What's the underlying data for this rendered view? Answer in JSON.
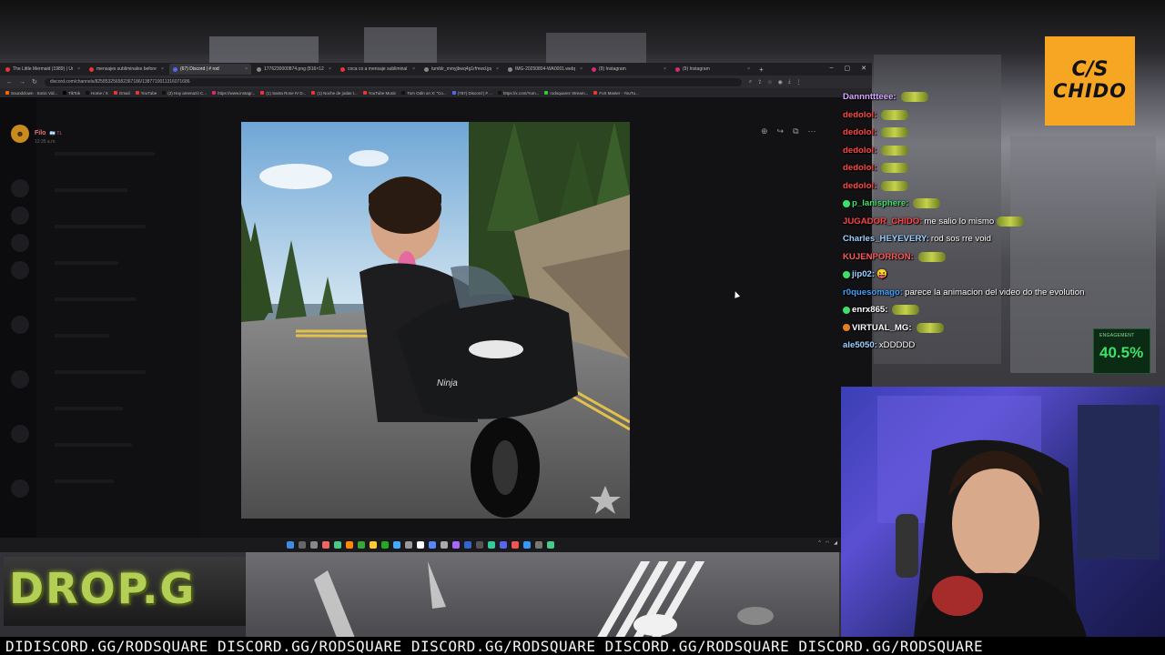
{
  "browser": {
    "tabs": [
      {
        "label": "The Little Mermaid (1989) | Un",
        "color": "#e33"
      },
      {
        "label": "mensajes subliminales before",
        "color": "#e33"
      },
      {
        "label": "(67) Discord | # rod",
        "color": "#5865f2",
        "active": true
      },
      {
        "label": "1776230000874.png (816×1216)",
        "color": "#888"
      },
      {
        "label": "coca co a mensaje subliminal",
        "color": "#e33"
      },
      {
        "label": "tumblr_mmyjbwq4g1rfmwd.jpg",
        "color": "#888"
      },
      {
        "label": "IMG-20250804-WA0001.webp",
        "color": "#888"
      },
      {
        "label": "(9) Instagram",
        "color": "#d62976"
      },
      {
        "label": "(9) Instagram",
        "color": "#d62976"
      }
    ],
    "new_tab": "+",
    "window_controls": [
      "–",
      "▢",
      "✕"
    ],
    "url": "discord.com/channels/825853256582367186/1387710011316071686",
    "bookmarks": [
      {
        "label": "Soundclown · Sonic Vid...",
        "color": "#f60"
      },
      {
        "label": "TikTok",
        "color": "#000"
      },
      {
        "label": "Home / X",
        "color": "#111"
      },
      {
        "label": "Gmail",
        "color": "#e33"
      },
      {
        "label": "YouTube",
        "color": "#e33"
      },
      {
        "label": "(2) Hoy amenazó C...",
        "color": "#111"
      },
      {
        "label": "https://www.instagr...",
        "color": "#d62976"
      },
      {
        "label": "(1) Santa Rose IV D...",
        "color": "#e33"
      },
      {
        "label": "(1) Noche de jodas t...",
        "color": "#e33"
      },
      {
        "label": "YouTube Music",
        "color": "#e33"
      },
      {
        "label": "Tom Odin on X: \"Co...",
        "color": "#111"
      },
      {
        "label": "(787) Discord | # ...",
        "color": "#5865f2"
      },
      {
        "label": "https://x.com/Yum...",
        "color": "#111"
      },
      {
        "label": "rodsquarez Stream...",
        "color": "#3c3"
      },
      {
        "label": "Fort Master - YouTu...",
        "color": "#e33"
      }
    ]
  },
  "discord": {
    "user_name": "Filo",
    "user_badge": "🇦🇷 TL",
    "timestamp": "12:35 a.m."
  },
  "chat": {
    "messages": [
      {
        "user": "Dannnttteee:",
        "color": "#d7a7ff",
        "text": "",
        "emote": true
      },
      {
        "user": "dedolol:",
        "color": "#ff4545",
        "text": "",
        "emote": true
      },
      {
        "user": "dedolol:",
        "color": "#ff4545",
        "text": "",
        "emote": true
      },
      {
        "user": "dedolol:",
        "color": "#ff4545",
        "text": "",
        "emote": true
      },
      {
        "user": "dedolol:",
        "color": "#ff4545",
        "text": "",
        "emote": true
      },
      {
        "user": "dedolol:",
        "color": "#ff4545",
        "text": "",
        "emote": true
      },
      {
        "user": "p_lanisphere:",
        "color": "#3fe06a",
        "text": "",
        "emote": true,
        "badge": "#3fe06a"
      },
      {
        "user": "JUGADOR_CHIDO:",
        "color": "#ff4545",
        "text": "me salio lo mismo",
        "emote": true
      },
      {
        "user": "Charles_HEYEVERY:",
        "color": "#9bd0ff",
        "text": "rod sos rre void",
        "emote": false
      },
      {
        "user": "KUJENPORRON:",
        "color": "#ff5a5a",
        "text": "",
        "emote": true
      },
      {
        "user": "jip02:",
        "color": "#9bd0ff",
        "text": "😝",
        "emote": false,
        "badge": "#3fe06a"
      },
      {
        "user": "r0quesomago:",
        "color": "#3fa0ff",
        "text": "parece la animacion del video do the evolution",
        "emote": false
      },
      {
        "user": "enrx865:",
        "color": "#fff",
        "text": "",
        "emote": true,
        "badge": "#3fe06a"
      },
      {
        "user": "VIRTUAL_MG:",
        "color": "#fff",
        "text": "",
        "emote": true,
        "badge": "#e67e22"
      },
      {
        "user": "ale5050:",
        "color": "#9bd0ff",
        "text": "xDDDDD",
        "emote": false
      }
    ]
  },
  "engagement": {
    "label": "ENGAGEMENT",
    "value": "40.5%"
  },
  "logo": {
    "line1": "C/S",
    "line2": "CHIDO"
  },
  "drop_text": "DROP.G",
  "ticker": "DIDISCORD.GG/RODSQUARE DISCORD.GG/RODSQUARE DISCORD.GG/RODSQUARE DISCORD.GG/RODSQUARE DISCORD.GG/RODSQUARE",
  "photo": {
    "motorcycle_brand": "Ninja"
  }
}
